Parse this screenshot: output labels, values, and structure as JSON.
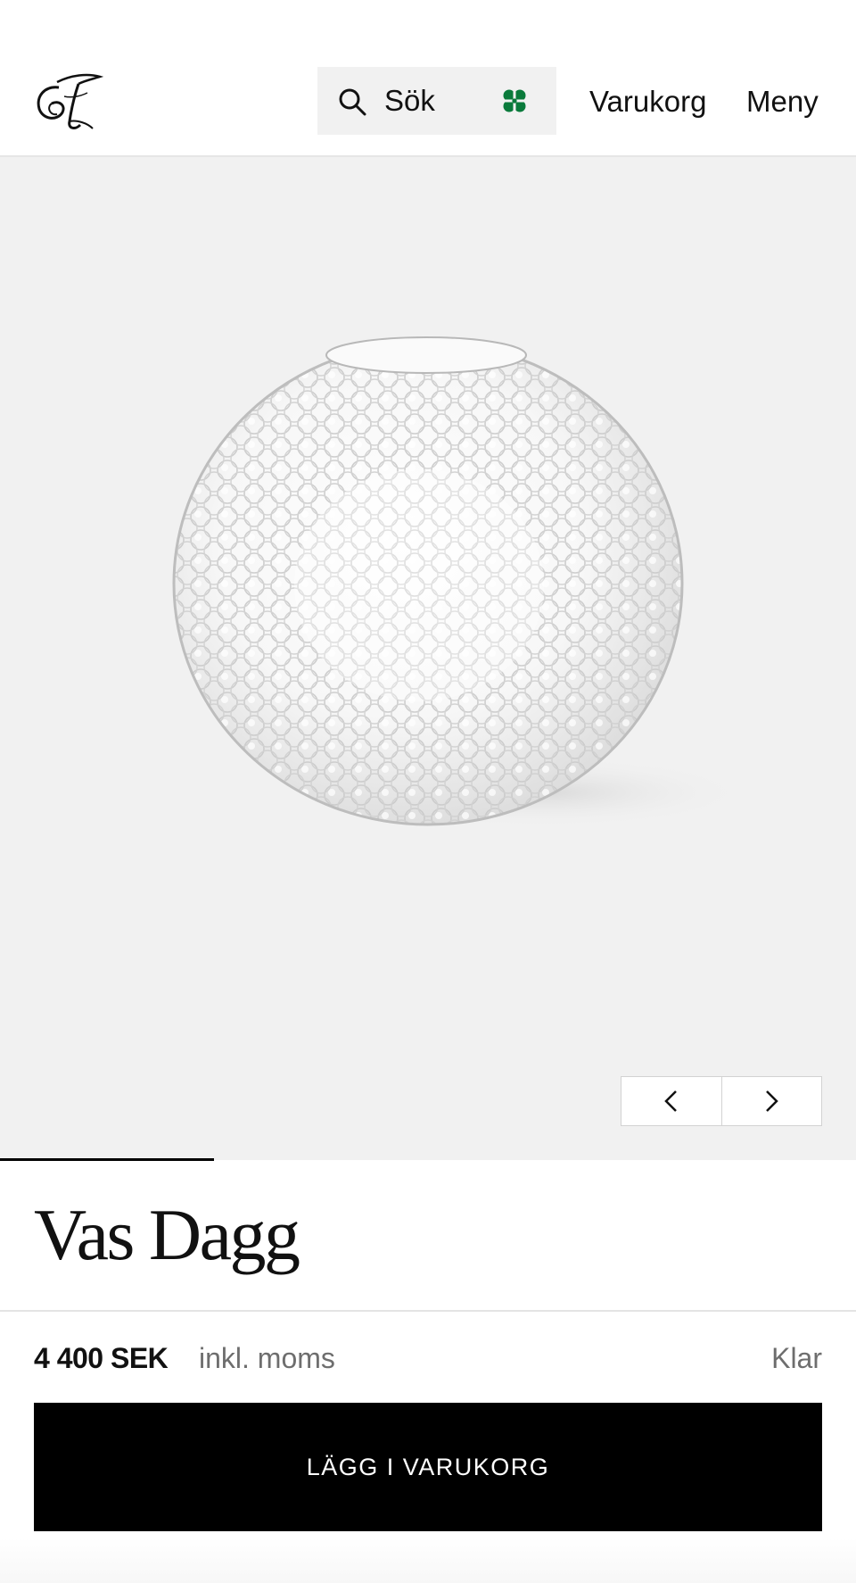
{
  "header": {
    "logo_text": "ST",
    "search_label": "Sök",
    "cart_label": "Varukorg",
    "menu_label": "Meny"
  },
  "gallery": {
    "prev_icon": "chevron-left-icon",
    "next_icon": "chevron-right-icon",
    "progress_fraction": 0.25
  },
  "product": {
    "title": "Vas Dagg",
    "price": "4 400 SEK",
    "vat_note": "inkl. moms",
    "status": "Klar",
    "add_to_cart_label": "LÄGG I VARUKORG"
  },
  "colors": {
    "accent_clover": "#0a7a3b",
    "button_bg": "#000000",
    "gallery_bg": "#f1f1f1"
  }
}
